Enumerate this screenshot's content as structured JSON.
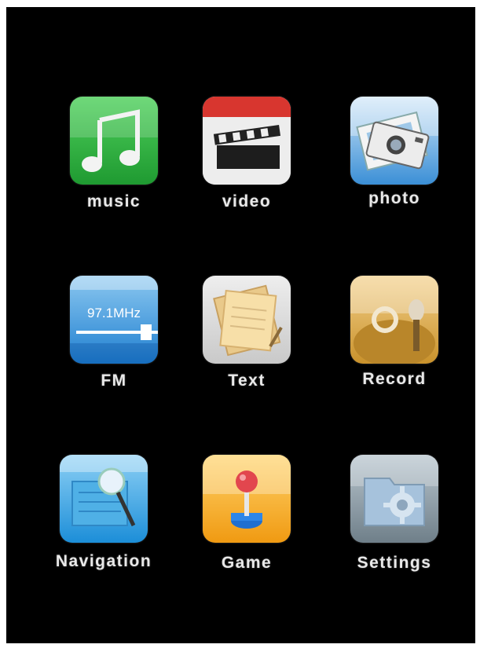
{
  "apps": [
    {
      "label": "music",
      "icon": "music-note-icon"
    },
    {
      "label": "video",
      "icon": "clapperboard-icon"
    },
    {
      "label": "photo",
      "icon": "camera-photo-icon"
    },
    {
      "label": "FM",
      "icon": "radio-tuner-icon",
      "display_text": "97.1MHz"
    },
    {
      "label": "Text",
      "icon": "notes-document-icon"
    },
    {
      "label": "Record",
      "icon": "microphone-icon"
    },
    {
      "label": "Navigation",
      "icon": "map-magnifier-icon"
    },
    {
      "label": "Game",
      "icon": "joystick-icon"
    },
    {
      "label": "Settings",
      "icon": "gear-folder-icon"
    }
  ],
  "colors": {
    "background": "#000000",
    "label": "#e9e9e9",
    "music": "#2fae3f",
    "video_stripe": "#d8362f",
    "fm": "#2a8fd8",
    "record": "#c8962e",
    "game": "#f3a31b"
  }
}
